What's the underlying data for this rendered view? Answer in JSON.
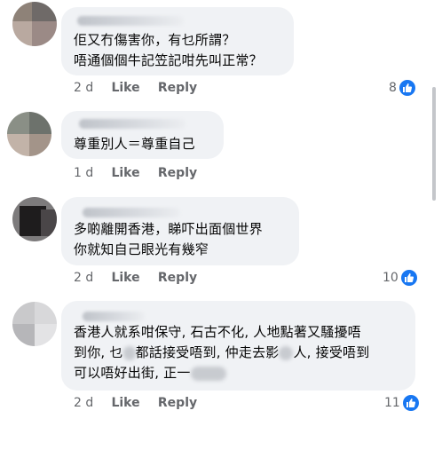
{
  "comments": [
    {
      "lines": [
        "佢又冇傷害你，有乜所謂？",
        "唔通個個牛記笠記咁先叫正常？"
      ],
      "time": "2 d",
      "like": "Like",
      "reply": "Reply",
      "reactions": "8"
    },
    {
      "lines": [
        "尊重別人＝尊重自己"
      ],
      "time": "1 d",
      "like": "Like",
      "reply": "Reply",
      "reactions": ""
    },
    {
      "lines": [
        "多啲離開香港，睇吓出面個世界",
        "你就知自己眼光有幾窄"
      ],
      "time": "2 d",
      "like": "Like",
      "reply": "Reply",
      "reactions": "10"
    },
    {
      "line1": "香港人就系咁保守, 石古不化, 人地點著又騷擾唔",
      "line2a": "到你, 乜",
      "line2b": "都話接受唔到, 仲走去影",
      "line2c": "人, 接受唔到",
      "line3": "可以唔好出街, 正一",
      "time": "2 d",
      "like": "Like",
      "reply": "Reply",
      "reactions": "11"
    }
  ],
  "icons": {
    "reaction": "like-thumb-icon"
  },
  "colors": {
    "bubble": "#f0f2f5",
    "meta": "#65676b",
    "accent": "#1877f2"
  }
}
